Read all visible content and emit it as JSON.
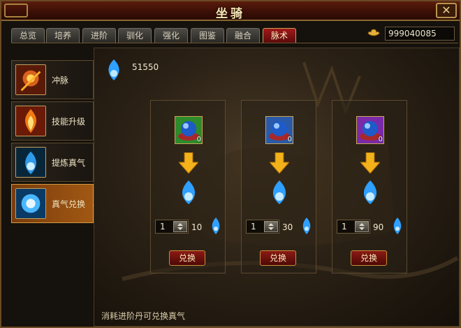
{
  "window": {
    "title": "坐骑",
    "close_symbol": "✕"
  },
  "tabs": [
    {
      "label": "总览",
      "active": false
    },
    {
      "label": "培养",
      "active": false
    },
    {
      "label": "进阶",
      "active": false
    },
    {
      "label": "驯化",
      "active": false
    },
    {
      "label": "强化",
      "active": false
    },
    {
      "label": "图鉴",
      "active": false
    },
    {
      "label": "融合",
      "active": false
    },
    {
      "label": "脉术",
      "active": true
    }
  ],
  "currency": {
    "icon": "gold-ingot-icon",
    "amount": "999040085"
  },
  "sidebar": [
    {
      "label": "冲脉",
      "icon": "meridian-icon",
      "active": false
    },
    {
      "label": "技能升级",
      "icon": "skill-upgrade-icon",
      "active": false
    },
    {
      "label": "提炼真气",
      "icon": "refine-qi-icon",
      "active": false
    },
    {
      "label": "真气兑换",
      "icon": "qi-exchange-icon",
      "active": true,
      "arrow": "〈"
    }
  ],
  "main": {
    "qi_total": "51550",
    "footer_note": "消耗进阶丹可兑换真气",
    "panels": [
      {
        "item": "advancement-pill-green",
        "stack": "0",
        "qty": "1",
        "cost": "10",
        "button": "兑换",
        "slot_color": "#2e8a2a"
      },
      {
        "item": "advancement-pill-blue",
        "stack": "0",
        "qty": "1",
        "cost": "30",
        "button": "兑换",
        "slot_color": "#2a5aa8"
      },
      {
        "item": "advancement-pill-purple",
        "stack": "0",
        "qty": "1",
        "cost": "90",
        "button": "兑换",
        "slot_color": "#7a2aa8"
      }
    ]
  },
  "colors": {
    "active_tab": "#a0191a",
    "active_side": "#a15813",
    "qi_blue": "#3aa8ff",
    "arrow_gold": "#f3b21a"
  }
}
